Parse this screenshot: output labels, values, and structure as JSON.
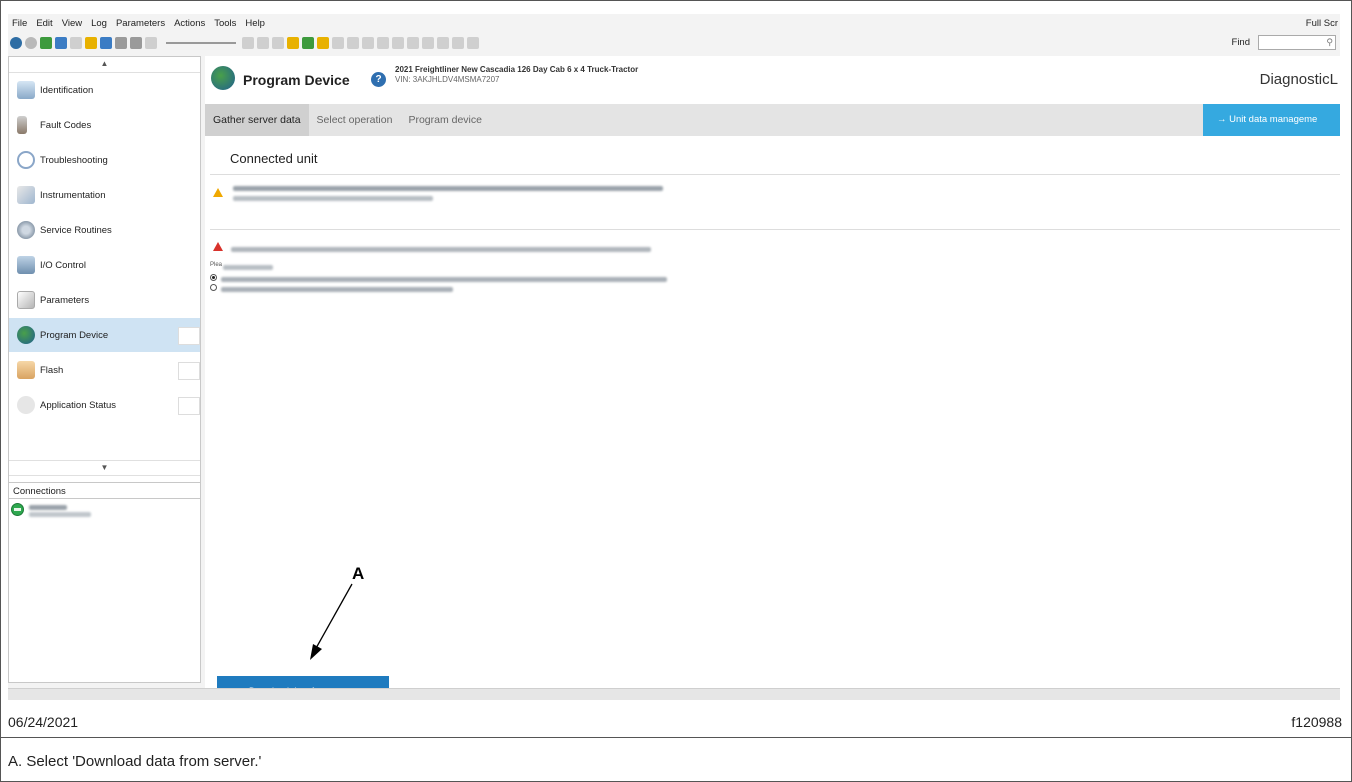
{
  "menu": [
    "File",
    "Edit",
    "View",
    "Log",
    "Parameters",
    "Actions",
    "Tools",
    "Help"
  ],
  "full_screen_label": "Full Scr",
  "find": {
    "label": "Find",
    "value": ""
  },
  "sidebar": {
    "items": [
      {
        "label": "Identification",
        "icon": "identification-icon"
      },
      {
        "label": "Fault Codes",
        "icon": "fault-codes-icon"
      },
      {
        "label": "Troubleshooting",
        "icon": "troubleshooting-icon"
      },
      {
        "label": "Instrumentation",
        "icon": "instrumentation-icon"
      },
      {
        "label": "Service Routines",
        "icon": "service-routines-icon"
      },
      {
        "label": "I/O Control",
        "icon": "io-control-icon"
      },
      {
        "label": "Parameters",
        "icon": "parameters-icon"
      },
      {
        "label": "Program Device",
        "icon": "program-device-icon",
        "selected": true
      },
      {
        "label": "Flash",
        "icon": "flash-icon"
      },
      {
        "label": "Application Status",
        "icon": "application-status-icon"
      }
    ],
    "connections_title": "Connections"
  },
  "header": {
    "title": "Program Device",
    "vehicle": "2021 Freightliner New Cascadia 126 Day Cab 6 x 4 Truck-Tractor",
    "vin": "VIN: 3AKJHLDV4MSMA7207",
    "brand": "DiagnosticL"
  },
  "tabs": [
    "Gather server data",
    "Select operation",
    "Program device"
  ],
  "unit_data_button": "→ Unit data manageme",
  "connected_unit_title": "Connected unit",
  "radio_prefix": "Plea",
  "download_button": "Download data from server",
  "callout_letter": "A",
  "footer": {
    "date": "06/24/2021",
    "figure_id": "f120988",
    "caption": "A. Select 'Download data from server.'"
  },
  "colors": {
    "accent_blue": "#1f7bbf",
    "unit_data_blue": "#35a9e0",
    "selected_nav": "#cfe3f3",
    "warning_amber": "#f0a800",
    "warning_red": "#d8322b",
    "connection_green": "#2ea84f"
  }
}
